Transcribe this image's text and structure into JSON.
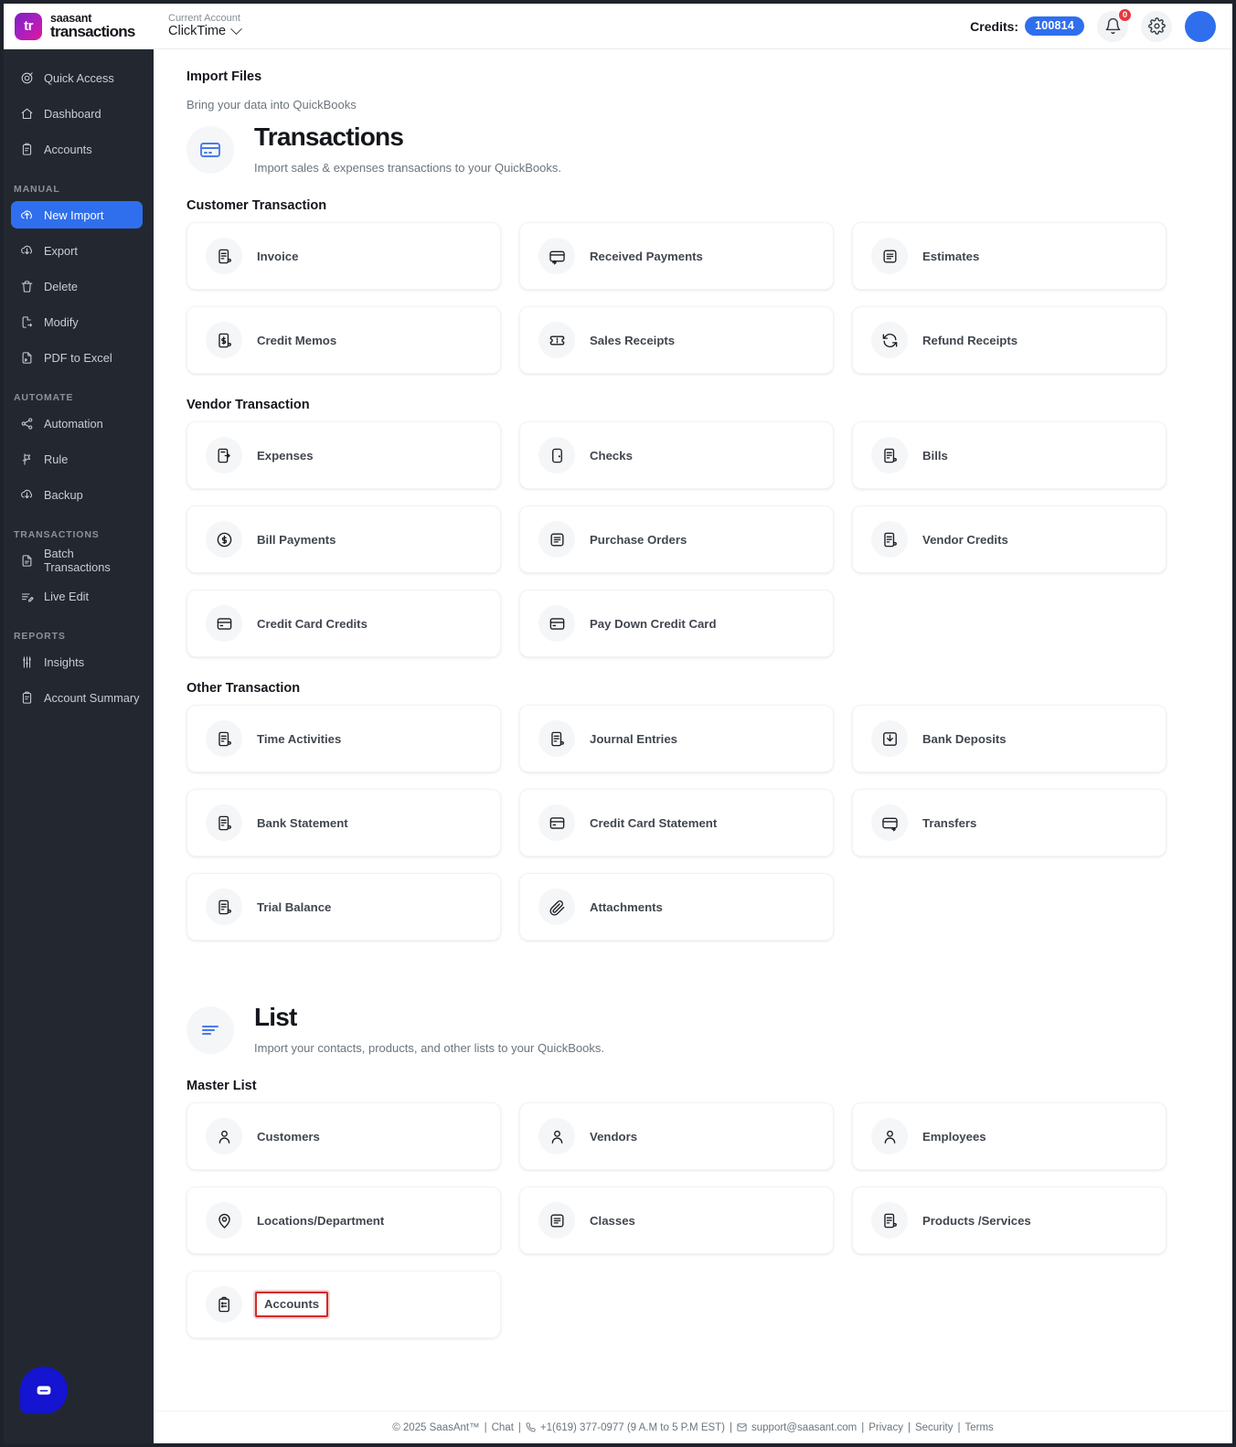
{
  "brand": {
    "top": "saasant",
    "bottom": "transactions",
    "mark": "tr"
  },
  "account": {
    "label": "Current Account",
    "value": "ClickTime"
  },
  "topbar": {
    "credits_label": "Credits:",
    "credits_value": "100814",
    "notification_count": "0",
    "notification_icon": "bell-icon",
    "settings_icon": "gear-icon",
    "avatar": "user-avatar"
  },
  "sidebar": {
    "top_items": [
      {
        "label": "Quick Access",
        "icon": "target-icon",
        "active": false
      },
      {
        "label": "Dashboard",
        "icon": "home-icon",
        "active": false
      },
      {
        "label": "Accounts",
        "icon": "clipboard-icon",
        "active": false
      }
    ],
    "sections": [
      {
        "title": "MANUAL",
        "items": [
          {
            "label": "New Import",
            "icon": "upload-cloud-icon",
            "active": true
          },
          {
            "label": "Export",
            "icon": "download-cloud-icon",
            "active": false
          },
          {
            "label": "Delete",
            "icon": "trash-icon",
            "active": false
          },
          {
            "label": "Modify",
            "icon": "file-edit-icon",
            "active": false
          },
          {
            "label": "PDF to Excel",
            "icon": "pdf-file-icon",
            "active": false
          }
        ]
      },
      {
        "title": "AUTOMATE",
        "items": [
          {
            "label": "Automation",
            "icon": "share-nodes-icon",
            "active": false
          },
          {
            "label": "Rule",
            "icon": "rule-flag-icon",
            "active": false
          },
          {
            "label": "Backup",
            "icon": "download-cloud-icon",
            "active": false
          }
        ]
      },
      {
        "title": "TRANSACTIONS",
        "items": [
          {
            "label": "Batch Transactions",
            "icon": "document-icon",
            "active": false
          },
          {
            "label": "Live Edit",
            "icon": "edit-list-icon",
            "active": false
          }
        ]
      },
      {
        "title": "REPORTS",
        "items": [
          {
            "label": "Insights",
            "icon": "sliders-icon",
            "active": false
          },
          {
            "label": "Account Summary",
            "icon": "clipboard-icon",
            "active": false
          }
        ]
      }
    ]
  },
  "main": {
    "import_title": "Import Files",
    "import_sub": "Bring your data into QuickBooks",
    "transactions": {
      "icon": "credit-card-icon",
      "title": "Transactions",
      "desc": "Import sales & expenses transactions to your QuickBooks.",
      "groups": [
        {
          "title": "Customer Transaction",
          "cards": [
            {
              "label": "Invoice",
              "icon": "invoice-clipboard-icon"
            },
            {
              "label": "Received Payments",
              "icon": "card-in-icon"
            },
            {
              "label": "Estimates",
              "icon": "document-lines-icon"
            },
            {
              "label": "Credit Memos",
              "icon": "money-clipboard-icon"
            },
            {
              "label": "Sales Receipts",
              "icon": "ticket-icon"
            },
            {
              "label": "Refund Receipts",
              "icon": "refresh-icon"
            }
          ]
        },
        {
          "title": "Vendor Transaction",
          "cards": [
            {
              "label": "Expenses",
              "icon": "expense-out-icon"
            },
            {
              "label": "Checks",
              "icon": "check-page-icon"
            },
            {
              "label": "Bills",
              "icon": "invoice-clipboard-icon"
            },
            {
              "label": "Bill Payments",
              "icon": "dollar-circle-icon"
            },
            {
              "label": "Purchase Orders",
              "icon": "document-lines-icon"
            },
            {
              "label": "Vendor Credits",
              "icon": "invoice-clipboard-icon"
            },
            {
              "label": "Credit Card Credits",
              "icon": "credit-card-icon"
            },
            {
              "label": "Pay Down Credit Card",
              "icon": "credit-card-icon"
            },
            {
              "label": "",
              "icon": ""
            }
          ]
        },
        {
          "title": "Other Transaction",
          "cards": [
            {
              "label": "Time Activities",
              "icon": "invoice-clipboard-icon"
            },
            {
              "label": "Journal Entries",
              "icon": "invoice-clipboard-icon"
            },
            {
              "label": "Bank Deposits",
              "icon": "inbox-down-icon"
            },
            {
              "label": "Bank Statement",
              "icon": "invoice-clipboard-icon"
            },
            {
              "label": "Credit Card Statement",
              "icon": "credit-card-icon"
            },
            {
              "label": "Transfers",
              "icon": "card-out-icon"
            },
            {
              "label": "Trial Balance",
              "icon": "invoice-clipboard-icon"
            },
            {
              "label": "Attachments",
              "icon": "paperclip-icon"
            },
            {
              "label": "",
              "icon": ""
            }
          ]
        }
      ]
    },
    "list": {
      "icon": "list-lines-icon",
      "title": "List",
      "desc": "Import your contacts, products, and other lists to your QuickBooks.",
      "groups": [
        {
          "title": "Master List",
          "cards": [
            {
              "label": "Customers",
              "icon": "user-icon"
            },
            {
              "label": "Vendors",
              "icon": "user-icon"
            },
            {
              "label": "Employees",
              "icon": "user-icon"
            },
            {
              "label": "Locations/Department",
              "icon": "map-pin-icon"
            },
            {
              "label": "Classes",
              "icon": "document-lines-icon"
            },
            {
              "label": "Products /Services",
              "icon": "invoice-clipboard-icon"
            },
            {
              "label": "Accounts",
              "icon": "checklist-clipboard-icon",
              "highlighted": true
            },
            {
              "label": "",
              "icon": ""
            },
            {
              "label": "",
              "icon": ""
            }
          ]
        }
      ]
    }
  },
  "footer": {
    "copyright": "© 2025 SaasAnt™",
    "chat": "Chat",
    "phone": "+1(619) 377-0977 (9 A.M to 5 P.M EST)",
    "email": "support@saasant.com",
    "privacy": "Privacy",
    "security": "Security",
    "terms": "Terms",
    "sep": "|"
  },
  "chat_widget": {
    "icon": "chat-bubble-icon"
  },
  "colors": {
    "accent": "#2f6fed",
    "sidebar": "#232830",
    "highlight": "#cf2a2a",
    "chat": "#1414d1"
  }
}
